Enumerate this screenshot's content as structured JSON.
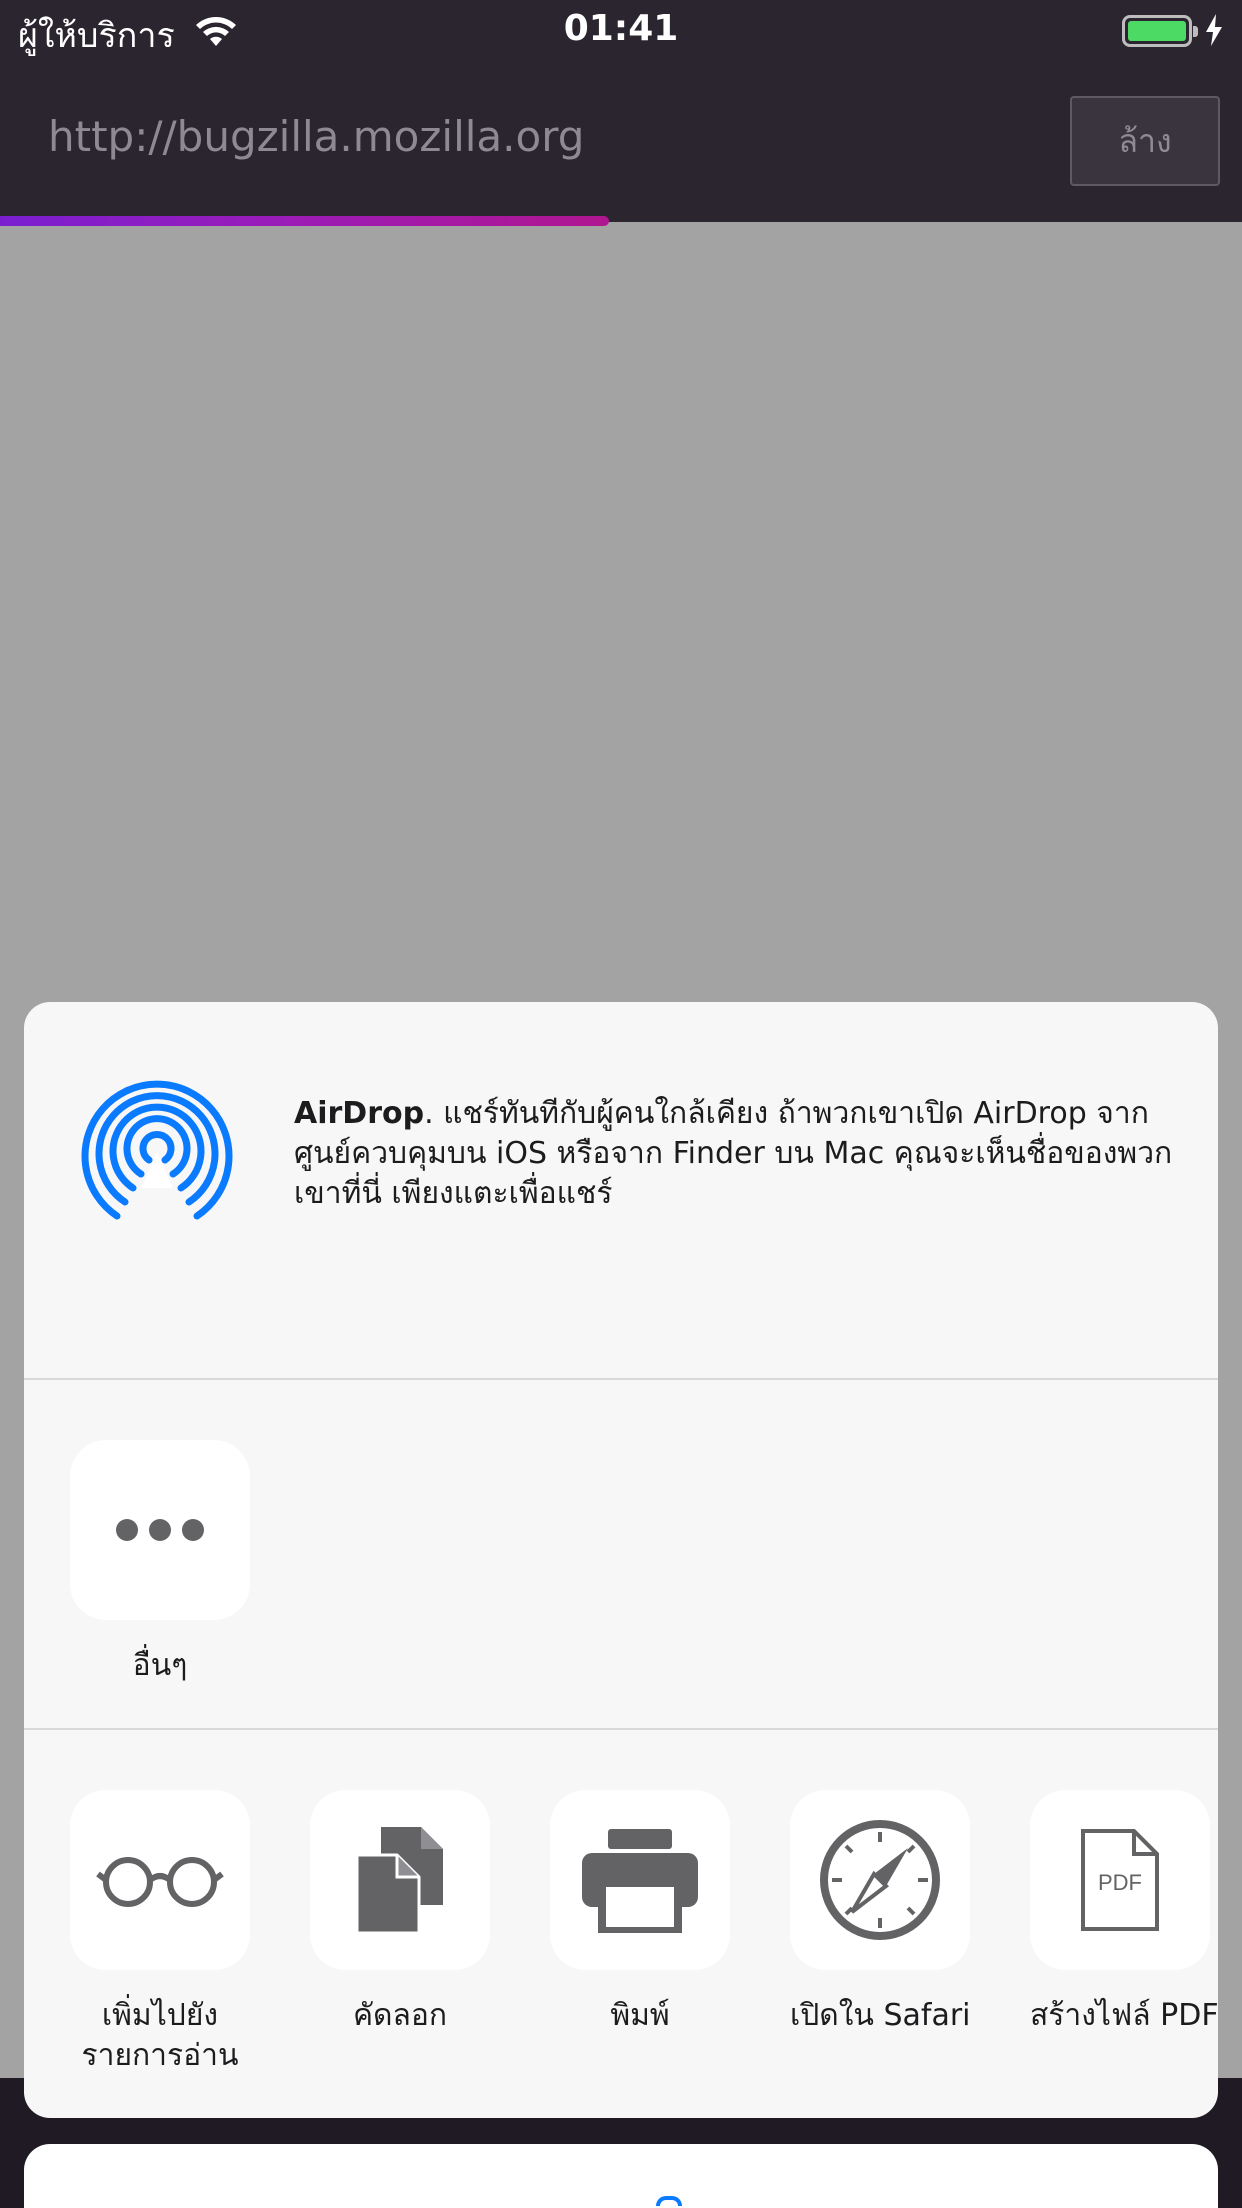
{
  "status_bar": {
    "carrier": "ผู้ให้บริการ",
    "time": "01:41",
    "icons": [
      "wifi-icon",
      "battery-icon",
      "charging-bolt-icon"
    ]
  },
  "url_bar": {
    "url": "http://bugzilla.mozilla.org",
    "clear_label": "ล้าง",
    "load_progress": 0.49
  },
  "share_sheet": {
    "airdrop": {
      "title": "AirDrop",
      "description": ". แชร์ทันทีกับผู้คนใกล้เคียง ถ้าพวกเขาเปิด AirDrop จากศูนย์ควบคุมบน iOS หรือจาก Finder บน Mac คุณจะเห็นชื่อของพวกเขาที่นี่ เพียงแตะเพื่อแชร์",
      "icon": "airdrop-icon"
    },
    "share_apps": [
      {
        "label": "อื่นๆ",
        "icon": "more-icon"
      }
    ],
    "actions": [
      {
        "line1": "เพิ่มไปยัง",
        "line2": "รายการอ่าน",
        "icon": "glasses-icon"
      },
      {
        "line1": "คัดลอก",
        "line2": "",
        "icon": "copy-icon"
      },
      {
        "line1": "พิมพ์",
        "line2": "",
        "icon": "print-icon"
      },
      {
        "line1": "เปิดใน Safari",
        "line2": "",
        "icon": "safari-compass-icon"
      },
      {
        "line1": "สร้างไฟล์ PDF",
        "line2": "",
        "icon": "pdf-file-icon"
      }
    ]
  },
  "colors": {
    "accent": "#0A7AFF",
    "airdrop_blue": "#0A7AFF",
    "progress_start": "#7A1FD0",
    "progress_end": "#B0168F",
    "icon_gray": "#636366"
  }
}
